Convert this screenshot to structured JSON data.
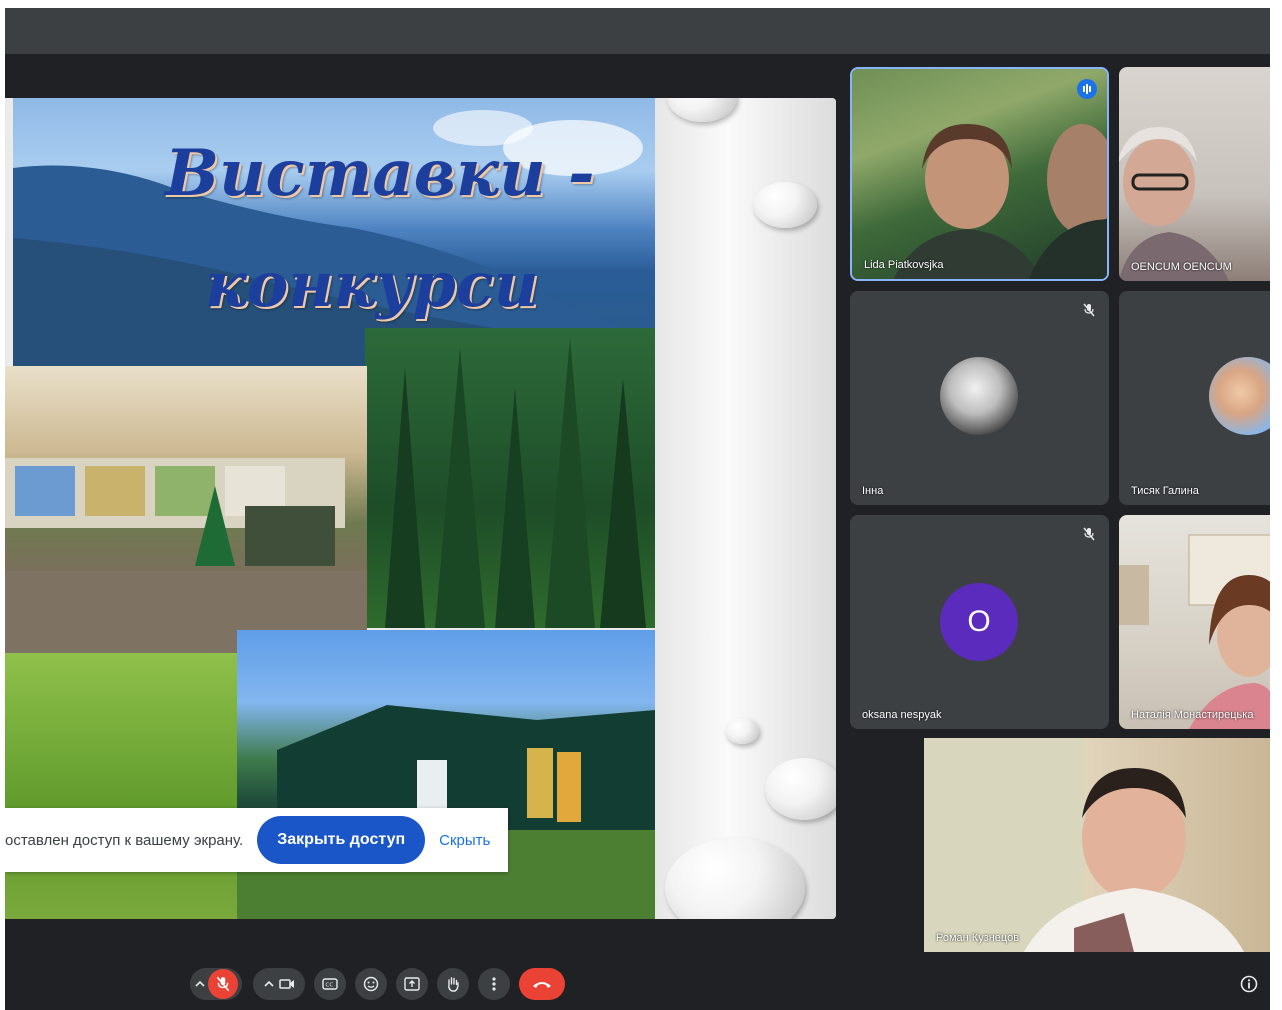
{
  "slide": {
    "title_line1": "Виставки -",
    "title_line2": "конкурси"
  },
  "share_notice": {
    "message": "оставлен доступ к вашему экрану.",
    "stop_label": "Закрыть доступ",
    "hide_label": "Скрыть"
  },
  "participants": [
    {
      "name": "Lida Piatkovsjka",
      "muted": false,
      "speaking": true,
      "video": true
    },
    {
      "name": "OENCUM OENCUM",
      "muted": false,
      "video": true
    },
    {
      "name": "Інна",
      "muted": true,
      "video": false
    },
    {
      "name": "Тисяк Галина",
      "muted": false,
      "video": false
    },
    {
      "name": "oksana nespyak",
      "muted": true,
      "video": false,
      "initial": "O"
    },
    {
      "name": "Наталія Монастирецька",
      "muted": false,
      "video": true
    },
    {
      "name": "Роман Кузнецов",
      "muted": false,
      "video": true
    }
  ],
  "controls": {
    "icons": [
      "chevron-up-icon",
      "mic-off-icon",
      "chevron-up-icon",
      "camera-icon",
      "captions-icon",
      "emoji-icon",
      "present-icon",
      "raise-hand-icon",
      "more-icon",
      "end-call-icon",
      "info-icon"
    ]
  },
  "colors": {
    "background": "#202124",
    "tile": "#3c4043",
    "accent": "#1a73e8",
    "danger": "#ea4335",
    "avatar": "#5b2bbd"
  }
}
